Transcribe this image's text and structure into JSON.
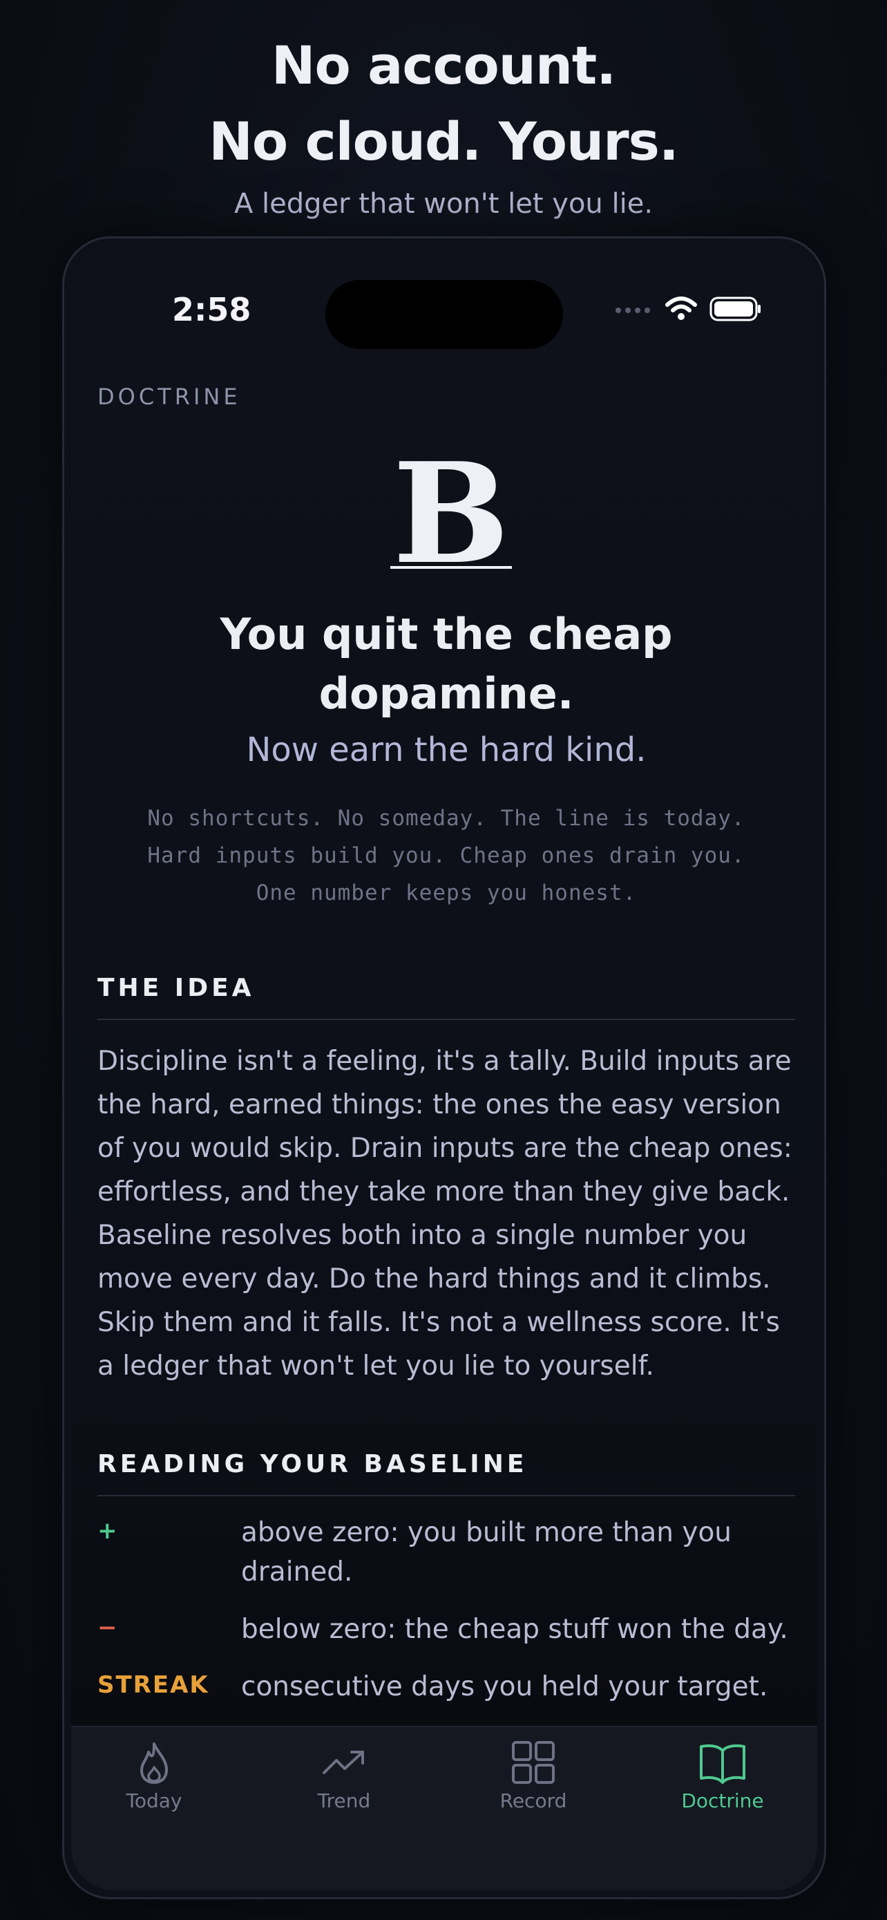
{
  "hero": {
    "headline_line1": "No account.",
    "headline_line2": "No cloud. Yours.",
    "tagline": "A ledger that won't let you lie."
  },
  "status_bar": {
    "time": "2:58"
  },
  "page": {
    "section_label": "DOCTRINE",
    "logo_letter": "B",
    "title_line1": "You quit the cheap",
    "title_line2": "dopamine.",
    "subtitle": "Now earn the hard kind.",
    "manifesto": [
      "No shortcuts. No someday. The line is today.",
      "Hard inputs build you. Cheap ones drain you.",
      "One number keeps you honest."
    ],
    "idea": {
      "heading": "THE IDEA",
      "body": "Discipline isn't a feeling, it's a tally. Build inputs are the hard, earned things: the ones the easy version of you would skip. Drain inputs are the cheap ones: effortless, and they take more than they give back. Baseline resolves both into a single number you move every day. Do the hard things and it climbs. Skip them and it falls. It's not a wellness score. It's a ledger that won't let you lie to yourself."
    },
    "reading": {
      "heading": "READING YOUR BASELINE",
      "items": [
        {
          "key": "+",
          "text": "above zero: you built more than you drained."
        },
        {
          "key": "−",
          "text": "below zero: the cheap stuff won the day."
        },
        {
          "key": "STREAK",
          "text": "consecutive days you held your target."
        }
      ]
    }
  },
  "tabs": [
    {
      "label": "Today",
      "icon": "flame-icon"
    },
    {
      "label": "Trend",
      "icon": "trend-icon"
    },
    {
      "label": "Record",
      "icon": "grid-icon"
    },
    {
      "label": "Doctrine",
      "icon": "book-icon"
    }
  ],
  "colors": {
    "accent_green": "#4fc98f",
    "negative_red": "#e0614a",
    "streak_amber": "#e8a13a"
  }
}
